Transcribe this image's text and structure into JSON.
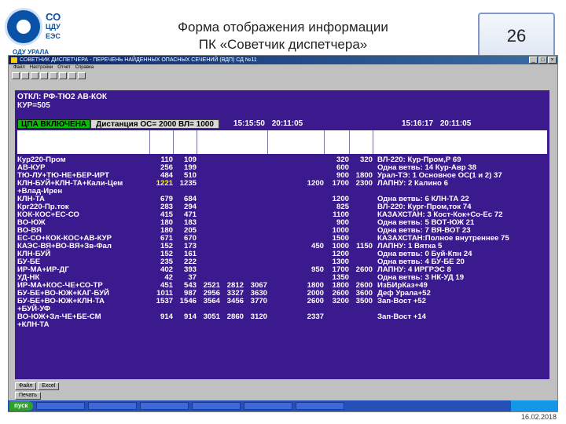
{
  "slide": {
    "title_line1": "Форма отображения информации",
    "title_line2": "ПК «Советчик диспетчера»",
    "page_number": "26",
    "footer_date": "16.02.2018",
    "logo_text_line1": "СО",
    "logo_text_line2": "ЦДУ",
    "logo_text_line3": "ЕЭС",
    "logo_sub": "ОДУ УРАЛА"
  },
  "window": {
    "title": "СОВЕТНИК ДИСПЕТЧЕРА - ПЕРЕЧЕНЬ НАЙДЕННЫХ ОПАСНЫХ СЕЧЕНИЙ (ВДП) СД №11",
    "menu": [
      "Файл",
      "Настройки",
      "Отчет",
      "Справка"
    ]
  },
  "alarm": {
    "line1": "ОТКЛ: РФ-ТЮ2  АВ-КОК",
    "line2": "КУР=505"
  },
  "status": {
    "cpa": "ЦПА ВКЛЮЧЕНА",
    "distance": "Дистанция ОС= 2000 ВЛ= 1000",
    "time1": "15:15:50",
    "date1": "20:11:05",
    "time2": "15:16:17",
    "date2": "20:11:05"
  },
  "table": {
    "rows": [
      [
        "Кур220-Пром",
        "110",
        "109",
        "",
        "",
        "",
        "",
        "320",
        "320",
        "ВЛ-220: Кур-Пром,Р 69"
      ],
      [
        "АВ-КУР",
        "256",
        "199",
        "",
        "",
        "",
        "",
        "600",
        "",
        "Одна ветвь: 14 Кур-Авр 38"
      ],
      [
        "ТЮ-ЛУ+ТЮ-НЕ+БЕР-ИРТ",
        "484",
        "510",
        "",
        "",
        "",
        "",
        "900",
        "1800",
        "Урал-ТЭ: 1 Основное ОС(1 и 2)  37"
      ],
      [
        "КЛН-БУЙ+КЛН-ТА+Кали-Цем",
        "1221",
        "1235",
        "",
        "",
        "",
        "1200",
        "1700",
        "2300",
        "ЛАПНУ: 2 Калино 6"
      ],
      [
        "+Влад-Ирен",
        "",
        "",
        "",
        "",
        "",
        "",
        "",
        "",
        ""
      ],
      [
        "КЛН-ТА",
        "679",
        "684",
        "",
        "",
        "",
        "",
        "1200",
        "",
        "Одна ветвь: 6 КЛН-ТА 22"
      ],
      [
        "Кpг220-Пр.ток",
        "283",
        "294",
        "",
        "",
        "",
        "",
        "825",
        "",
        "ВЛ-220: Кург-Пром,ток 74"
      ],
      [
        "КОК-КОС+ЕС-СО",
        "415",
        "471",
        "",
        "",
        "",
        "",
        "1100",
        "",
        "КАЗАХСТАН: 3 Кост-Кок+Со-Ес 72"
      ],
      [
        "ВО-ЮЖ",
        "180",
        "183",
        "",
        "",
        "",
        "",
        "900",
        "",
        "Одна ветвь: 5 ВОТ-ЮЖ 21"
      ],
      [
        "ВО-ВЯ",
        "180",
        "205",
        "",
        "",
        "",
        "",
        "1000",
        "",
        "Одна ветвь: 7 ВЯ-ВОТ 23"
      ],
      [
        "ЕС-СО+КОК-КОС+АВ-КУР",
        "671",
        "670",
        "",
        "",
        "",
        "",
        "1500",
        "",
        "КАЗАХСТАН:Полное внутреннее 75"
      ],
      [
        "КАЭС-ВЯ+ВО-ВЯ+Зв-Фал",
        "152",
        "173",
        "",
        "",
        "",
        "450",
        "1000",
        "1150",
        "ЛАПНУ: 1 Вятка 5"
      ],
      [
        "КЛН-БУЙ",
        "152",
        "161",
        "",
        "",
        "",
        "",
        "1200",
        "",
        "Одна ветвь: 0 Буй-Кпн 24"
      ],
      [
        "БУ-БЕ",
        "235",
        "222",
        "",
        "",
        "",
        "",
        "1300",
        "",
        "Одна ветвь: 4 БУ-БЕ 20"
      ],
      [
        "ИР-МА+ИР-ДГ",
        "402",
        "393",
        "",
        "",
        "",
        "950",
        "1700",
        "2600",
        "ЛАПНУ: 4 ИРГРЭС 8"
      ],
      [
        "УД-НК",
        "42",
        "37",
        "",
        "",
        "",
        "",
        "1350",
        "",
        "Одна ветвь: 3 НК-УД 19"
      ],
      [
        "ИР-МА+КОС-ЧЕ+СО-ТР",
        "451",
        "543",
        "2521",
        "2812",
        "3067",
        "1800",
        "1800",
        "2600",
        "ИзБИрКаз+49"
      ],
      [
        "БУ-БЕ+ВО-ЮЖ+КАГ-БУЙ",
        "1011",
        "987",
        "2956",
        "3327",
        "3630",
        "2000",
        "2600",
        "3600",
        "Деф Урала+52"
      ],
      [
        "БУ-БЕ+ВО-ЮЖ+КЛН-ТА",
        "1537",
        "1546",
        "3564",
        "3456",
        "3770",
        "2600",
        "3200",
        "3500",
        "Зап-Вост +52"
      ],
      [
        "+БУЙ-УФ",
        "",
        "",
        "",
        "",
        "",
        "",
        "",
        "",
        ""
      ],
      [
        "ВО-ЮЖ+Зл-ЧЕ+БЕ-СМ",
        "914",
        "914",
        "3051",
        "2860",
        "3120",
        "2337",
        "",
        "",
        "Зап-Вост +14"
      ],
      [
        "+КЛН-ТА",
        "",
        "",
        "",
        "",
        "",
        "",
        "",
        "",
        ""
      ]
    ]
  },
  "bottom": {
    "btn_a": "Файл",
    "btn_b": "Excel",
    "btn_c": "Печать"
  },
  "taskbar": {
    "start_label": "пуск"
  }
}
